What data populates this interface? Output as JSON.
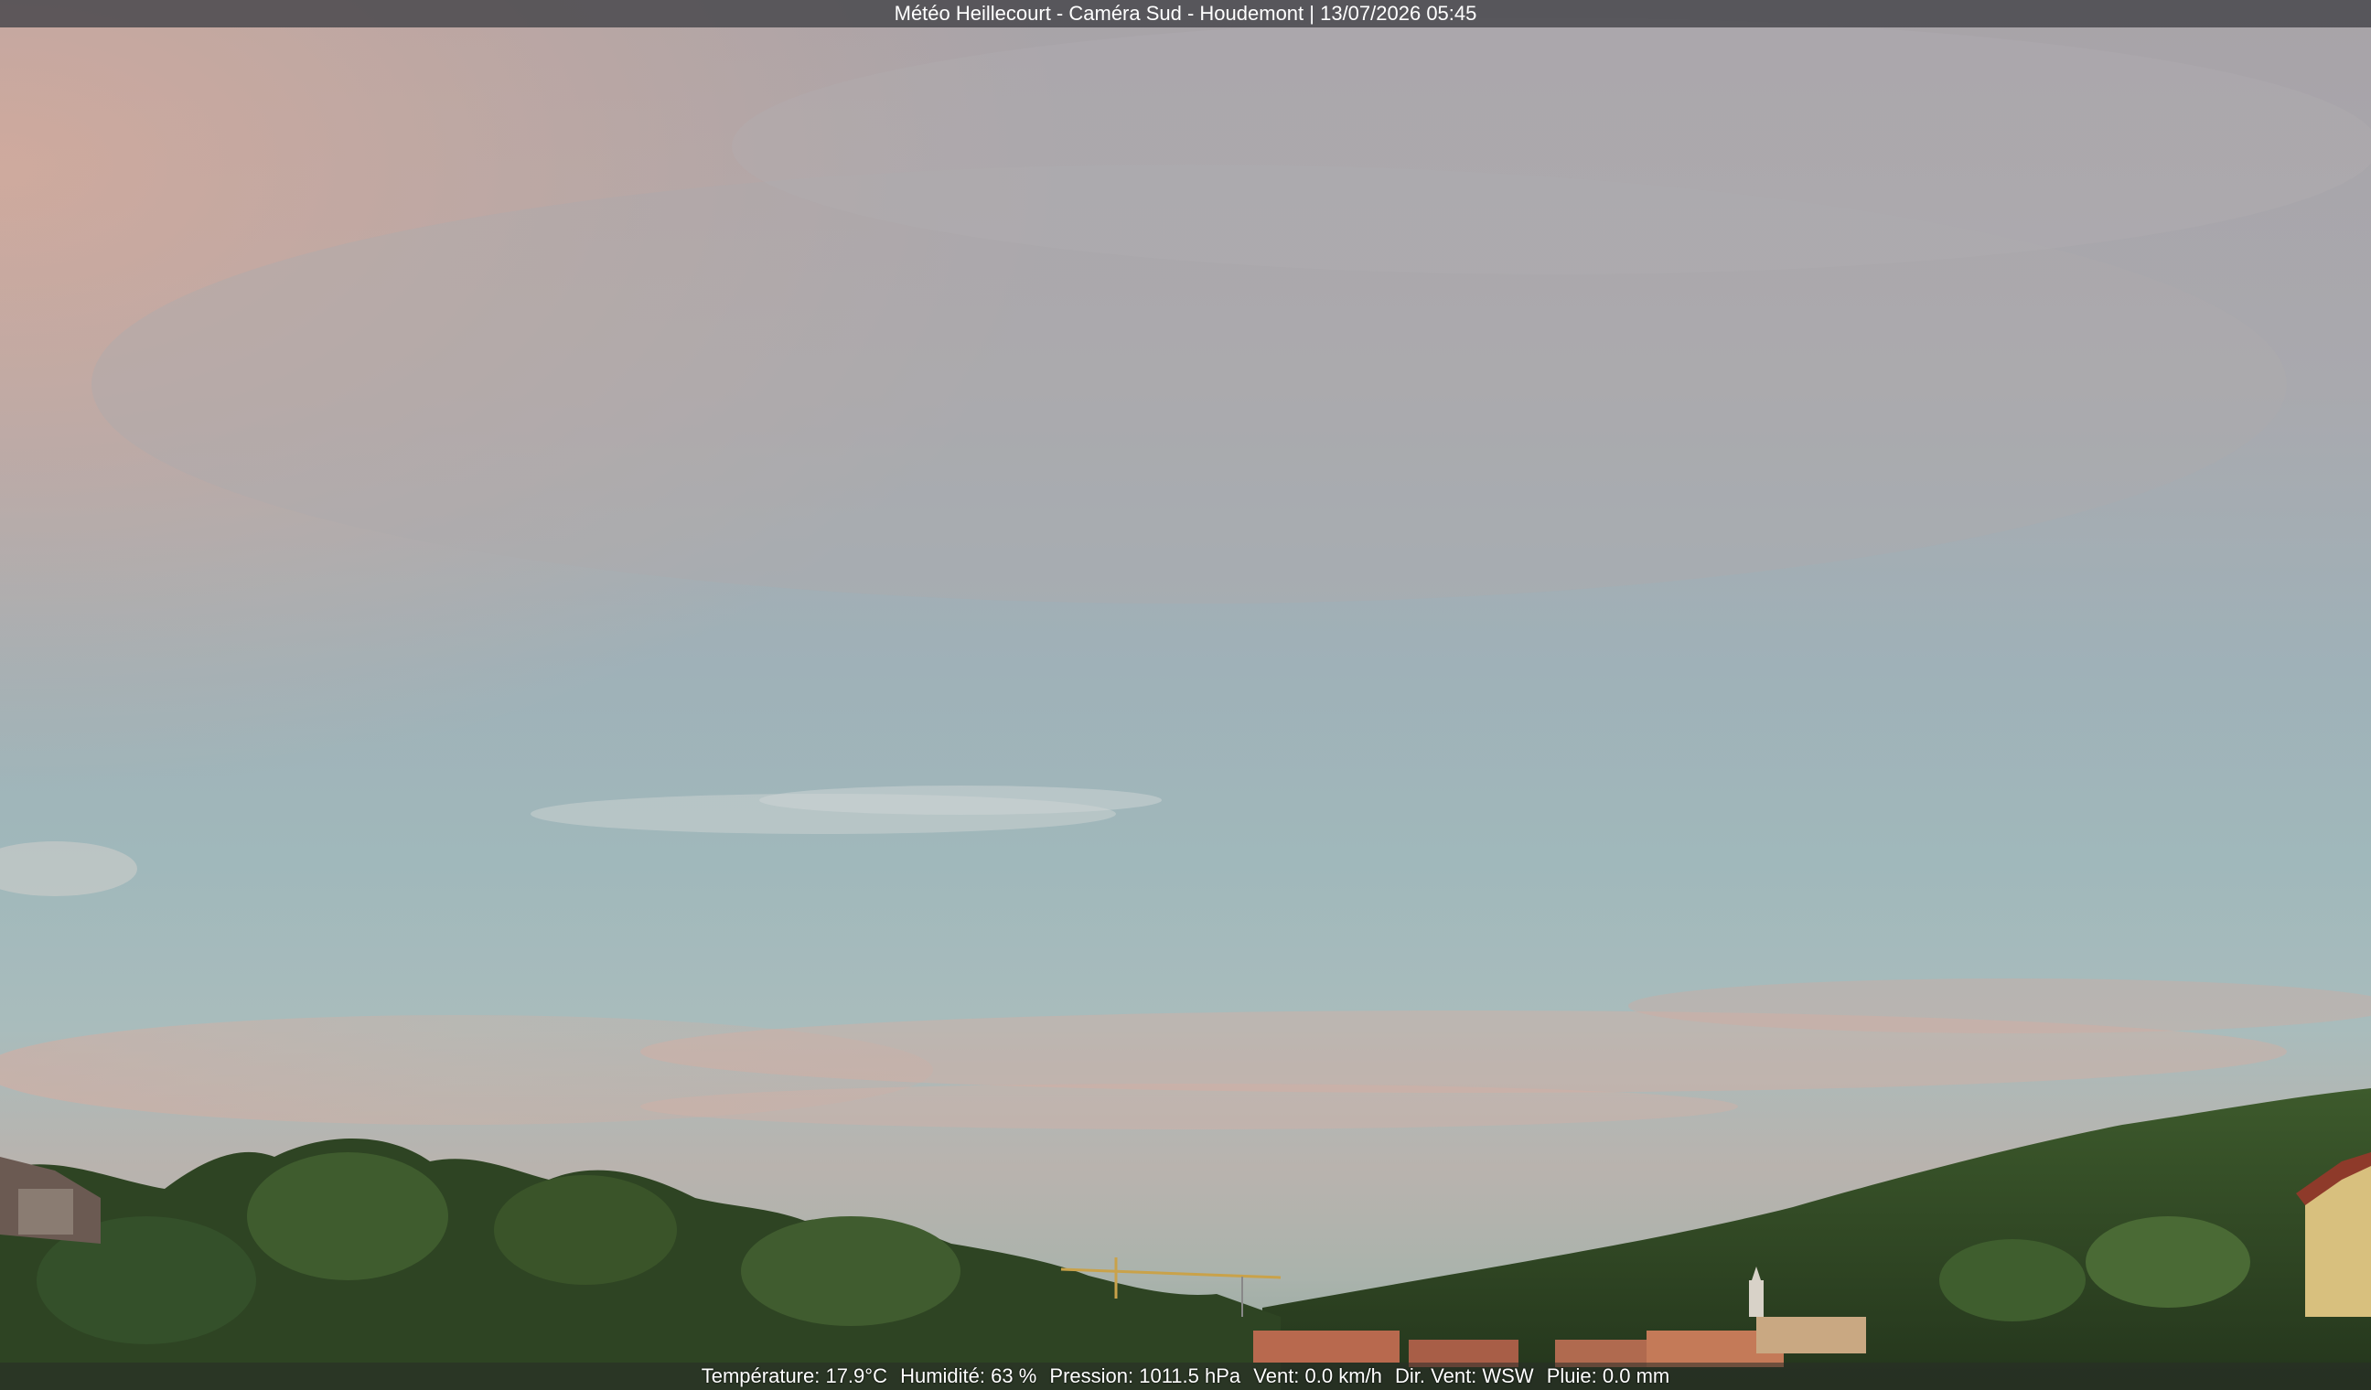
{
  "top_caption": "Météo Heillecourt - Caméra Sud - Houdemont | 13/07/2026 05:45",
  "weather": {
    "temperature": "Température: 17.9°C",
    "humidity": "Humidité: 63 %",
    "pressure": "Pression: 1011.5 hPa",
    "wind_speed": "Vent: 0.0 km/h",
    "wind_direction": "Dir. Vent: WSW",
    "rain": "Pluie: 0.0 mm"
  }
}
